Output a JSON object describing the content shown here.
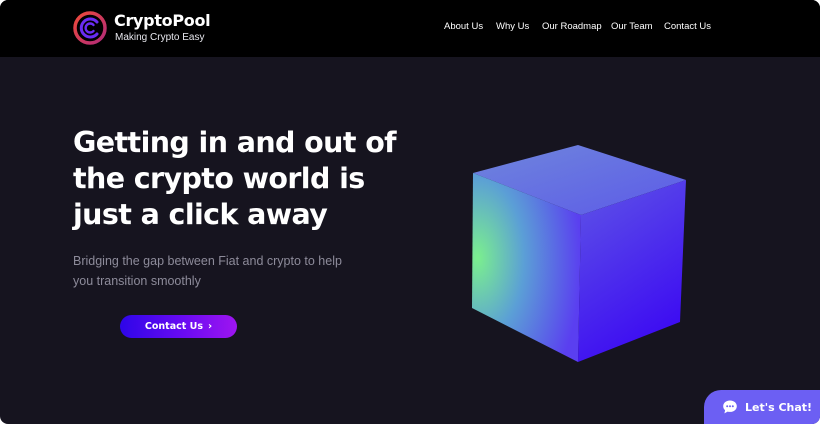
{
  "brand": {
    "name": "CryptoPool",
    "tagline": "Making Crypto Easy"
  },
  "nav": {
    "items": [
      {
        "label": "About Us"
      },
      {
        "label": "Why Us"
      },
      {
        "label": "Our Roadmap"
      },
      {
        "label": "Our Team"
      },
      {
        "label": "Contact Us"
      }
    ]
  },
  "hero": {
    "title": "Getting in and out of the crypto world is just a click away",
    "subtitle": "Bridging the gap between Fiat and crypto to help you transition smoothly",
    "cta_label": "Contact Us",
    "cta_icon": "chevron-right-icon"
  },
  "chat": {
    "label": "Let's Chat!",
    "icon": "chat-bubble-icon"
  },
  "colors": {
    "page_background": "#16141f",
    "header_background": "#000000",
    "cta_gradient_start": "#2e06e8",
    "cta_gradient_end": "#9e15f0",
    "chat_button": "#6c5ff3",
    "cube_green": "#7bef8e",
    "cube_blue": "#4b1df0",
    "logo_ring_red": "#e8433b",
    "logo_ring_purple": "#6a2cf2"
  }
}
